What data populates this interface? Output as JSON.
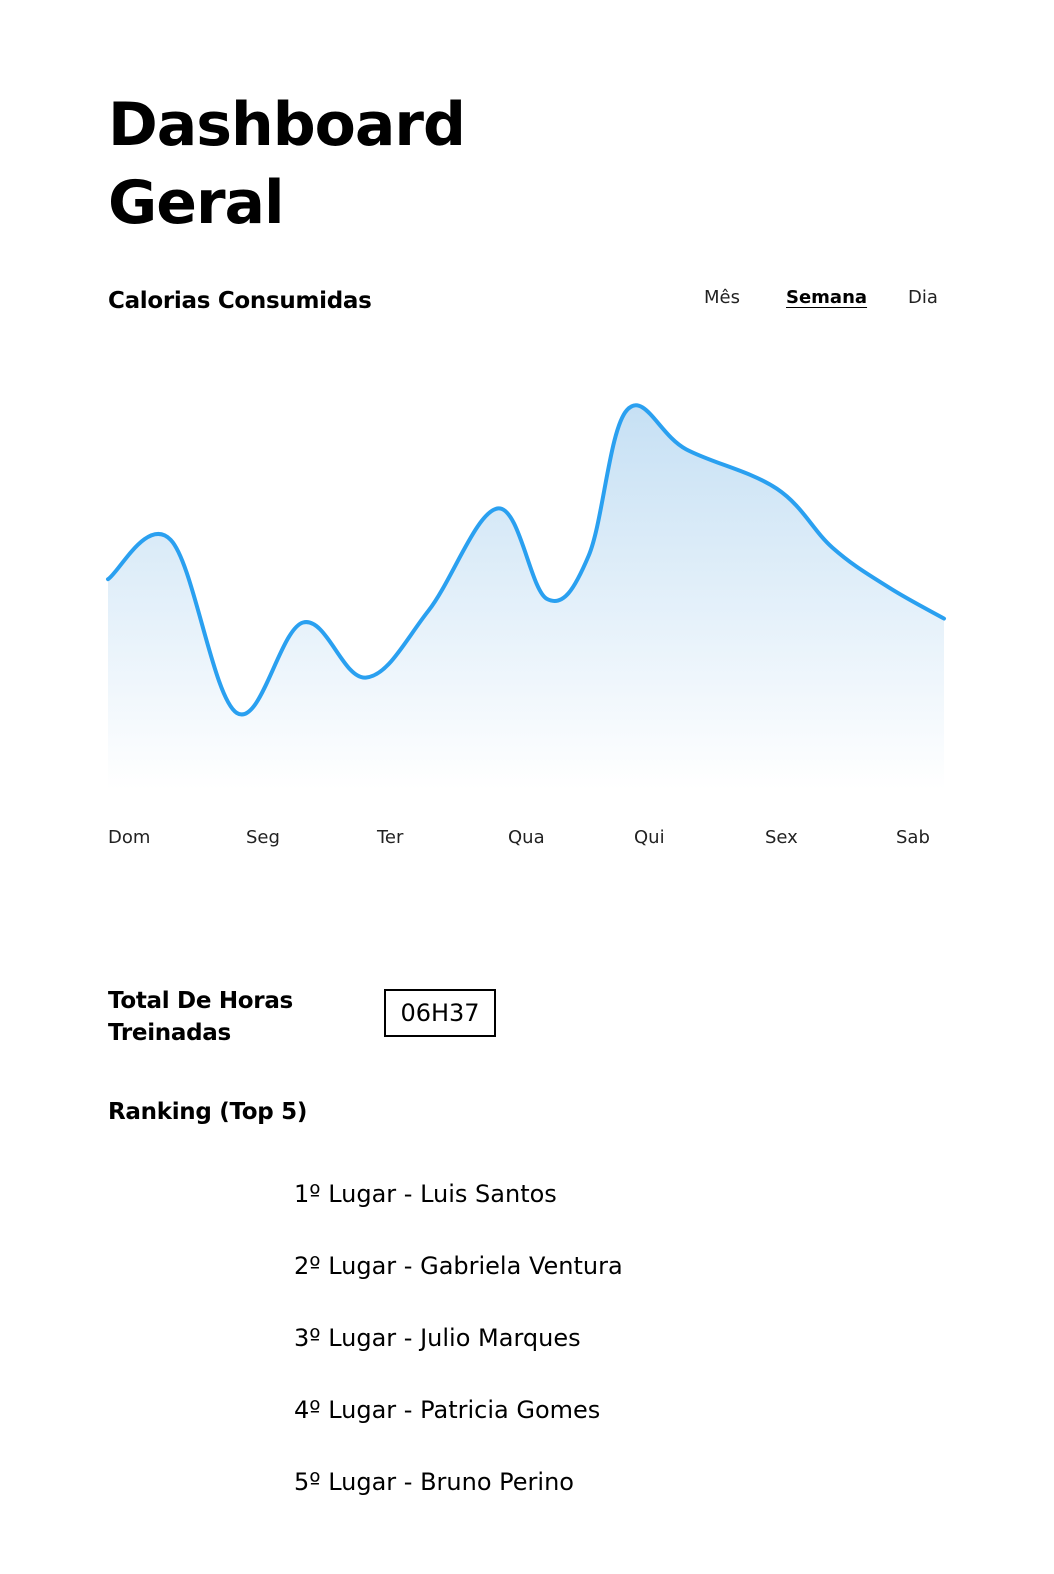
{
  "page": {
    "title": "Dashboard Geral"
  },
  "calories": {
    "heading": "Calorias Consumidas",
    "tabs": [
      {
        "label": "Mês",
        "active": false
      },
      {
        "label": "Semana",
        "active": true
      },
      {
        "label": "Dia",
        "active": false
      }
    ]
  },
  "chart_data": {
    "type": "area",
    "x": [
      "Dom",
      "Seg",
      "Ter",
      "Qua",
      "Qui",
      "Sex",
      "Sab"
    ],
    "x_positions": [
      0,
      0.9,
      1.85,
      2.8,
      3.7,
      4.6,
      5.6,
      6.3,
      6.9,
      7.45,
      8.3,
      9.6,
      10.4,
      11.2,
      12
    ],
    "values": [
      52,
      62,
      18,
      41,
      27,
      44,
      70,
      47,
      58,
      95,
      85,
      75,
      60,
      50,
      42
    ],
    "line_color": "#2aa0f0",
    "fill_color_top": "#c6e0f4",
    "fill_color_bottom": "#ffffff",
    "grid": false
  },
  "hours": {
    "heading": "Total De Horas Treinadas",
    "value": "06H37"
  },
  "ranking": {
    "heading": "Ranking (Top 5)",
    "items": [
      "1º Lugar - Luis Santos",
      "2º Lugar - Gabriela Ventura",
      "3º Lugar - Julio Marques",
      "4º Lugar - Patricia Gomes",
      "5º Lugar - Bruno Perino"
    ]
  }
}
